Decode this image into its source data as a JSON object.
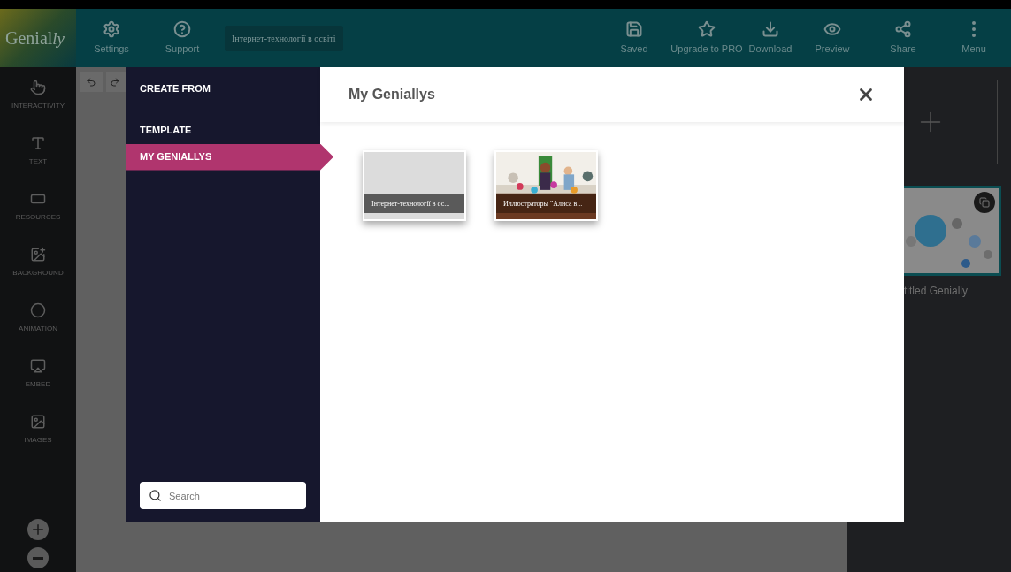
{
  "topbar": {
    "logo": "Genial",
    "logo_script": "ly",
    "left_actions": [
      {
        "kind": "settings",
        "label": "Settings"
      },
      {
        "kind": "support",
        "label": "Support"
      }
    ],
    "title": "Інтернет-технології в освіті",
    "right_actions": [
      {
        "kind": "saved",
        "label": "Saved"
      },
      {
        "kind": "star",
        "label": "Upgrade to PRO"
      },
      {
        "kind": "download",
        "label": "Download"
      },
      {
        "kind": "preview",
        "label": "Preview"
      },
      {
        "kind": "share",
        "label": "Share"
      },
      {
        "kind": "menu",
        "label": "Menu"
      }
    ]
  },
  "sidebar": {
    "items": [
      {
        "kind": "interactivity",
        "label": "INTERACTIVITY"
      },
      {
        "kind": "text",
        "label": "TEXT"
      },
      {
        "kind": "resources",
        "label": "RESOURCES"
      },
      {
        "kind": "background",
        "label": "BACKGROUND"
      },
      {
        "kind": "animation",
        "label": "ANIMATION"
      },
      {
        "kind": "embed",
        "label": "EMBED"
      },
      {
        "kind": "images",
        "label": "IMAGES"
      }
    ]
  },
  "pages_panel": {
    "page_title": "titled Genially"
  },
  "modal": {
    "heading": "CREATE FROM",
    "nav": [
      {
        "label": "TEMPLATE",
        "selected": false
      },
      {
        "label": "MY GENIALLYS",
        "selected": true
      }
    ],
    "search": {
      "placeholder": "Search"
    },
    "title": "My Geniallys",
    "cards": [
      {
        "kind": "blank",
        "caption": "Інтернет-технології в ос..."
      },
      {
        "kind": "picture",
        "caption": "Иллюстраторы \"Алиса в..."
      }
    ]
  }
}
